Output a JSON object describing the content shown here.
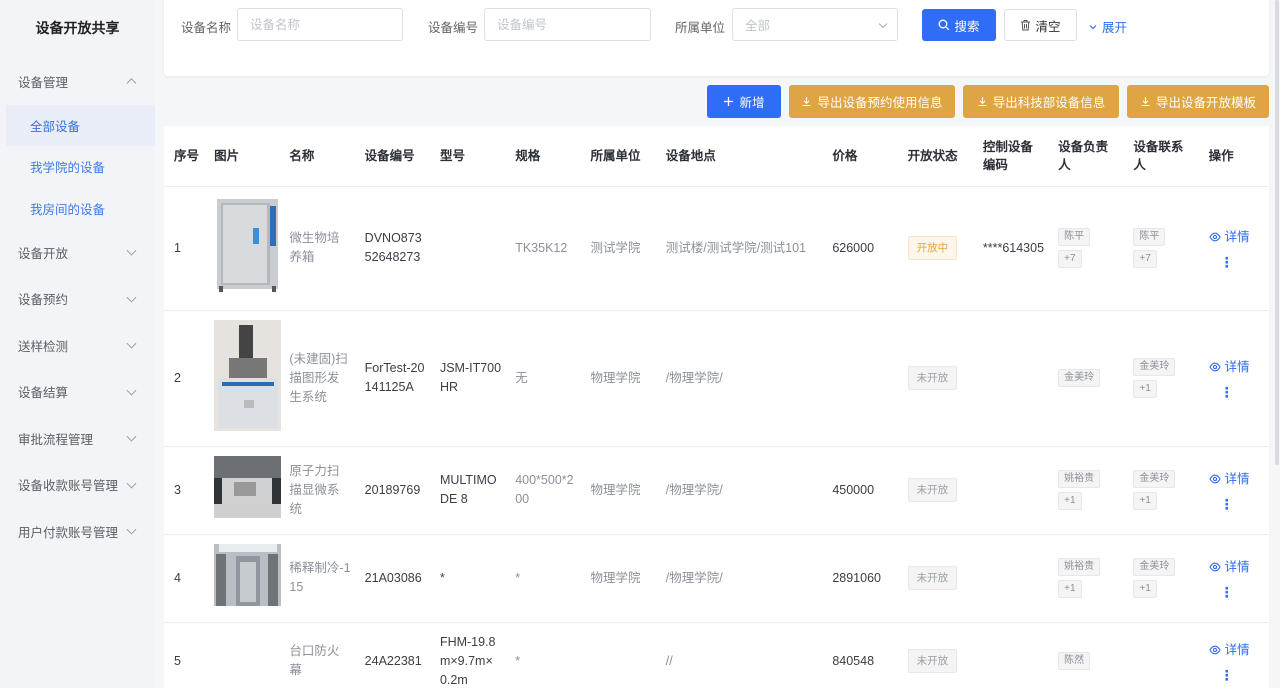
{
  "app": {
    "title": "设备开放共享"
  },
  "sidebar": {
    "items": [
      {
        "label": "设备管理",
        "expanded": true,
        "children": [
          {
            "label": "全部设备",
            "active": true
          },
          {
            "label": "我学院的设备",
            "active": false
          },
          {
            "label": "我房间的设备",
            "active": false
          }
        ]
      },
      {
        "label": "设备开放"
      },
      {
        "label": "设备预约"
      },
      {
        "label": "送样检测"
      },
      {
        "label": "设备结算"
      },
      {
        "label": "审批流程管理"
      },
      {
        "label": "设备收款账号管理"
      },
      {
        "label": "用户付款账号管理"
      }
    ]
  },
  "search": {
    "name_label": "设备名称",
    "name_placeholder": "设备名称",
    "code_label": "设备编号",
    "code_placeholder": "设备编号",
    "unit_label": "所属单位",
    "unit_value": "全部",
    "search_button": "搜索",
    "clear_button": "清空",
    "expand_link": "展开"
  },
  "actions": {
    "add": "新增",
    "export_booking": "导出设备预约使用信息",
    "export_tech": "导出科技部设备信息",
    "export_template": "导出设备开放模板"
  },
  "table": {
    "columns": [
      "序号",
      "图片",
      "名称",
      "设备编号",
      "型号",
      "规格",
      "所属单位",
      "设备地点",
      "价格",
      "开放状态",
      "控制设备编码",
      "设备负责人",
      "设备联系人",
      "操作"
    ],
    "detail_label": "详情",
    "more_label": "⋮",
    "rows": [
      {
        "index": "1",
        "image": "incubator",
        "name": "微生物培养箱",
        "code": "DVNO87352648273",
        "model": "",
        "spec": "TK35K12",
        "unit": "测试学院",
        "location": "测试楼/测试学院/测试101",
        "price": "626000",
        "status": "开放中",
        "status_open": true,
        "control_code": "****614305",
        "managers": [
          "陈平",
          "+7"
        ],
        "contacts": [
          "陈平",
          "+7"
        ]
      },
      {
        "index": "2",
        "image": "sem",
        "name": "(未建固)扫描图形发生系统",
        "code": "ForTest-20141125A",
        "model": "JSM-IT700HR",
        "spec": "无",
        "unit": "物理学院",
        "location": "/物理学院/",
        "price": "",
        "status": "未开放",
        "status_open": false,
        "control_code": "",
        "managers": [
          "金美玲"
        ],
        "contacts": [
          "金美玲",
          "+1"
        ]
      },
      {
        "index": "3",
        "image": "afm",
        "name": "原子力扫描显微系统",
        "code": "20189769",
        "model": "MULTIMODE 8",
        "spec": "400*500*200",
        "unit": "物理学院",
        "location": "/物理学院/",
        "price": "450000",
        "status": "未开放",
        "status_open": false,
        "control_code": "",
        "managers": [
          "姚裕贵",
          "+1"
        ],
        "contacts": [
          "金美玲",
          "+1"
        ]
      },
      {
        "index": "4",
        "image": "cryostat",
        "name": "稀释制冷-115",
        "code": "21A03086",
        "model": "*",
        "spec": "*",
        "unit": "物理学院",
        "location": "/物理学院/",
        "price": "2891060",
        "status": "未开放",
        "status_open": false,
        "control_code": "",
        "managers": [
          "姚裕贵",
          "+1"
        ],
        "contacts": [
          "金美玲",
          "+1"
        ]
      },
      {
        "index": "5",
        "image": "",
        "name": "台口防火幕",
        "code": "24A22381",
        "model": "FHM-19.8m×9.7m×0.2m",
        "spec": "*",
        "unit": "",
        "location": "//",
        "price": "840548",
        "status": "未开放",
        "status_open": false,
        "control_code": "",
        "managers": [
          "陈然"
        ],
        "contacts": []
      }
    ]
  }
}
